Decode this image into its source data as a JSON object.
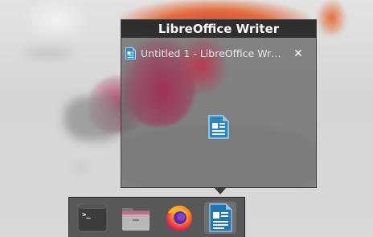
{
  "preview": {
    "app_name": "LibreOffice Writer",
    "window_title": "Untitled 1 - LibreOffice Writer",
    "close_glyph": "✕"
  },
  "dock": {
    "items": [
      {
        "icon": "terminal-icon",
        "prompt_glyph": ">_"
      },
      {
        "icon": "files-icon"
      },
      {
        "icon": "firefox-icon"
      },
      {
        "icon": "libreoffice-writer-icon",
        "active": true
      }
    ]
  },
  "colors": {
    "panel": "#6e6e6e",
    "title_bar": "#282828",
    "dock": "#3c3c3c",
    "accent_magenta": "#c0305a",
    "accent_orange": "#e8602a",
    "writer_blue": "#1e6fa8"
  }
}
